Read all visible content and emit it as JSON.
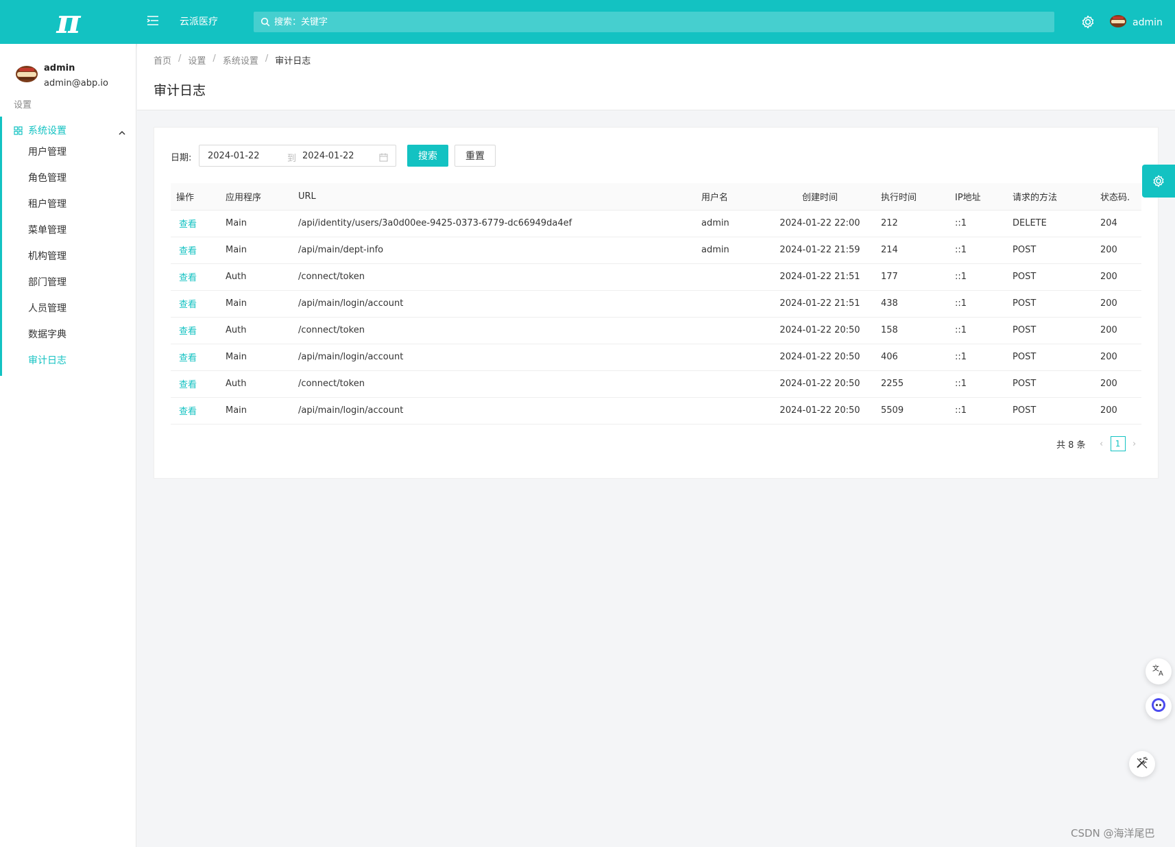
{
  "header": {
    "app_name": "云派医疗",
    "search_placeholder": "搜索：关键字",
    "user_name": "admin",
    "brand_color": "#13c2c2"
  },
  "sidebar": {
    "user": {
      "name": "admin",
      "email": "admin@abp.io"
    },
    "section_label": "设置",
    "group": {
      "label": "系统设置",
      "items": [
        {
          "label": "用户管理"
        },
        {
          "label": "角色管理"
        },
        {
          "label": "租户管理"
        },
        {
          "label": "菜单管理"
        },
        {
          "label": "机构管理"
        },
        {
          "label": "部门管理"
        },
        {
          "label": "人员管理"
        },
        {
          "label": "数据字典"
        },
        {
          "label": "审计日志",
          "active": true
        }
      ]
    }
  },
  "breadcrumb": [
    "首页",
    "设置",
    "系统设置",
    "审计日志"
  ],
  "page_title": "审计日志",
  "filter": {
    "label": "日期:",
    "start": "2024-01-22",
    "separator": "到",
    "end": "2024-01-22",
    "search_label": "搜索",
    "reset_label": "重置"
  },
  "table": {
    "headers": [
      "操作",
      "应用程序",
      "URL",
      "用户名",
      "创建时间",
      "执行时间",
      "IP地址",
      "请求的方法",
      "状态码."
    ],
    "action_label": "查看",
    "rows": [
      {
        "app": "Main",
        "url": "/api/identity/users/3a0d00ee-9425-0373-6779-dc66949da4ef",
        "user": "admin",
        "created": "2024-01-22 22:00",
        "duration": "212",
        "ip": "::1",
        "method": "DELETE",
        "status": "204"
      },
      {
        "app": "Main",
        "url": "/api/main/dept-info",
        "user": "admin",
        "created": "2024-01-22 21:59",
        "duration": "214",
        "ip": "::1",
        "method": "POST",
        "status": "200"
      },
      {
        "app": "Auth",
        "url": "/connect/token",
        "user": "",
        "created": "2024-01-22 21:51",
        "duration": "177",
        "ip": "::1",
        "method": "POST",
        "status": "200"
      },
      {
        "app": "Main",
        "url": "/api/main/login/account",
        "user": "",
        "created": "2024-01-22 21:51",
        "duration": "438",
        "ip": "::1",
        "method": "POST",
        "status": "200"
      },
      {
        "app": "Auth",
        "url": "/connect/token",
        "user": "",
        "created": "2024-01-22 20:50",
        "duration": "158",
        "ip": "::1",
        "method": "POST",
        "status": "200"
      },
      {
        "app": "Main",
        "url": "/api/main/login/account",
        "user": "",
        "created": "2024-01-22 20:50",
        "duration": "406",
        "ip": "::1",
        "method": "POST",
        "status": "200"
      },
      {
        "app": "Auth",
        "url": "/connect/token",
        "user": "",
        "created": "2024-01-22 20:50",
        "duration": "2255",
        "ip": "::1",
        "method": "POST",
        "status": "200"
      },
      {
        "app": "Main",
        "url": "/api/main/login/account",
        "user": "",
        "created": "2024-01-22 20:50",
        "duration": "5509",
        "ip": "::1",
        "method": "POST",
        "status": "200"
      }
    ]
  },
  "pagination": {
    "total_text": "共 8 条",
    "current_page": "1",
    "prev": "‹",
    "next": "›"
  },
  "watermark": "CSDN @海洋尾巴",
  "icons": {
    "logo": "π",
    "menu": "menu-icon",
    "search": "search-icon",
    "settings": "gear-icon",
    "translate": "translate-icon",
    "assistant": "assistant-icon",
    "magic": "magic-wand-icon"
  }
}
